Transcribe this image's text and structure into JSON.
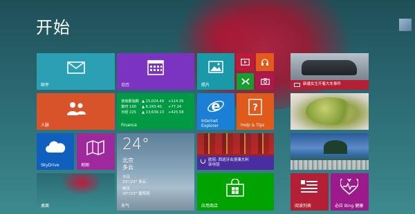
{
  "start": {
    "title": "开始"
  },
  "tiles": {
    "mail": {
      "label": "邮件"
    },
    "calendar": {
      "label": "日历"
    },
    "photos": {
      "label": "照片"
    },
    "people": {
      "label": "人脉"
    },
    "finance": {
      "label": "Finance",
      "rows": [
        {
          "name": "道琼斯指数",
          "value": "▲ 15,024.49",
          "change": "+114.35"
        },
        {
          "name": "富时 100",
          "value": "▲ 6,243.40",
          "change": "+77.24"
        },
        {
          "name": "日经 225",
          "value": "▲ 13,639.13",
          "change": "+425.58"
        }
      ]
    },
    "ie": {
      "label": "Internet\nExplorer",
      "line1": "Internet",
      "line2": "Explorer"
    },
    "help": {
      "label": "Help & Tips"
    },
    "skydrive": {
      "label": "SkyDrive"
    },
    "maps": {
      "label": "地图"
    },
    "weather": {
      "temp": "24°",
      "city": "北京",
      "condition": "多云",
      "today_label": "今日",
      "today_value": "33°/23° 多云",
      "tomorrow_label": "明天",
      "tomorrow_value": "30°/23° 雷阵雨",
      "label": "天气"
    },
    "sports": {
      "caption_line1": "欧冠: 西班牙击溃澳大利",
      "caption_line2": "亚夺冠"
    },
    "news": {
      "caption": "新疆女生开着大车事件"
    },
    "desktop": {
      "label": "桌面"
    },
    "store": {
      "label": "应用商店"
    },
    "reading": {
      "label": "阅读列表"
    },
    "health": {
      "label": "必应 Bing 健康"
    }
  },
  "colors": {
    "mail": "#2b9fb4",
    "calendar": "#7a34c0",
    "photos": "#1a9aa8",
    "people": "#d9532a",
    "finance": "#009a44",
    "ie": "#1b7fd6",
    "help": "#e05a1c",
    "skydrive": "#0f5fbf",
    "maps": "#a0289d",
    "store": "#00a300",
    "reading": "#b41f35",
    "health": "#9c1a8c",
    "video": "#c01a3b",
    "music": "#e45a1c",
    "games": "#199c31",
    "camera": "#b0174a"
  },
  "icons": [
    "mail-icon",
    "calendar-icon",
    "photos-icon",
    "people-icon",
    "ie-icon",
    "help-icon",
    "skydrive-icon",
    "maps-icon",
    "store-icon",
    "reading-list-icon",
    "heart-health-icon",
    "video-icon",
    "music-icon",
    "games-icon",
    "camera-icon"
  ]
}
